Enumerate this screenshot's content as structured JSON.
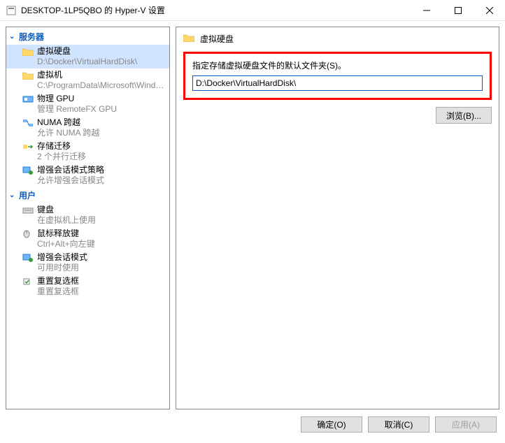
{
  "window": {
    "title": "DESKTOP-1LP5QBO 的 Hyper-V 设置"
  },
  "tree": {
    "server_header": "服务器",
    "user_header": "用户",
    "server_items": [
      {
        "label": "虚拟硬盘",
        "sub": "D:\\Docker\\VirtualHardDisk\\"
      },
      {
        "label": "虚拟机",
        "sub": "C:\\ProgramData\\Microsoft\\Windo..."
      },
      {
        "label": "物理 GPU",
        "sub": "管理 RemoteFX GPU"
      },
      {
        "label": "NUMA 跨越",
        "sub": "允许 NUMA 跨越"
      },
      {
        "label": "存储迁移",
        "sub": "2 个并行迁移"
      },
      {
        "label": "增强会话模式策略",
        "sub": "允许增强会话模式"
      }
    ],
    "user_items": [
      {
        "label": "键盘",
        "sub": "在虚拟机上使用"
      },
      {
        "label": "鼠标释放键",
        "sub": "Ctrl+Alt+向左键"
      },
      {
        "label": "增强会话模式",
        "sub": "可用时使用"
      },
      {
        "label": "重置复选框",
        "sub": "重置复选框"
      }
    ]
  },
  "detail": {
    "title": "虚拟硬盘",
    "field_label": "指定存储虚拟硬盘文件的默认文件夹(S)。",
    "field_value": "D:\\Docker\\VirtualHardDisk\\",
    "browse_label": "浏览(B)..."
  },
  "buttons": {
    "ok": "确定(O)",
    "cancel": "取消(C)",
    "apply": "应用(A)"
  }
}
